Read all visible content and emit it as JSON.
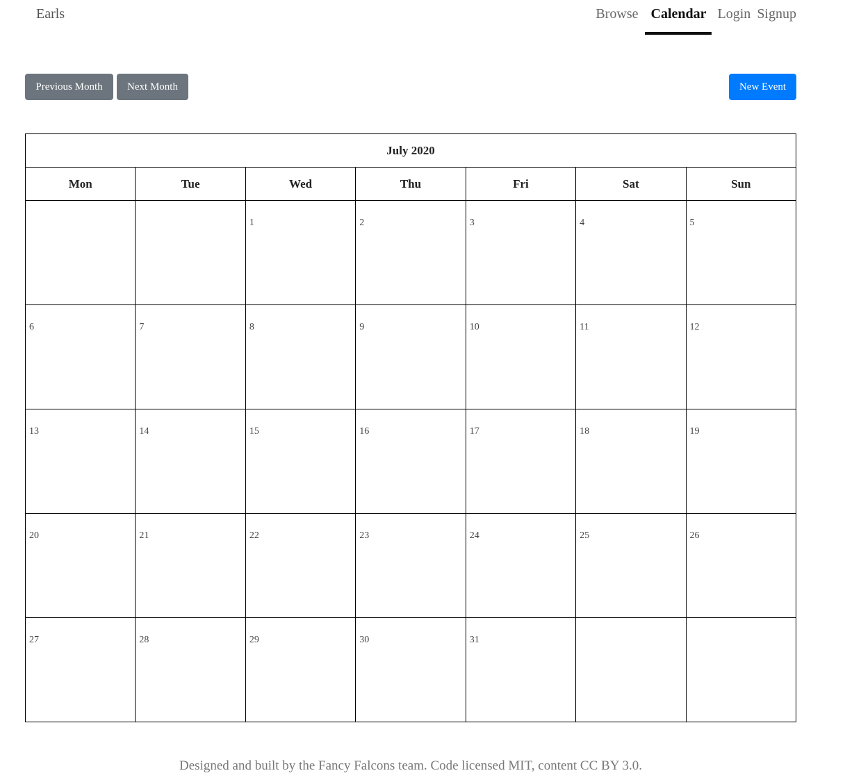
{
  "header": {
    "brand": "Earls",
    "nav": [
      {
        "label": "Browse",
        "active": false
      },
      {
        "label": "Calendar",
        "active": true
      },
      {
        "label": "Login",
        "active": false
      },
      {
        "label": "Signup",
        "active": false
      }
    ]
  },
  "toolbar": {
    "prev_label": "Previous Month",
    "next_label": "Next Month",
    "new_event_label": "New Event",
    "colors": {
      "secondary": "#6c757d",
      "primary": "#007bff"
    }
  },
  "calendar": {
    "month_title": "July 2020",
    "weekdays": [
      "Mon",
      "Tue",
      "Wed",
      "Thu",
      "Fri",
      "Sat",
      "Sun"
    ],
    "weeks": [
      [
        "",
        "",
        "1",
        "2",
        "3",
        "4",
        "5"
      ],
      [
        "6",
        "7",
        "8",
        "9",
        "10",
        "11",
        "12"
      ],
      [
        "13",
        "14",
        "15",
        "16",
        "17",
        "18",
        "19"
      ],
      [
        "20",
        "21",
        "22",
        "23",
        "24",
        "25",
        "26"
      ],
      [
        "27",
        "28",
        "29",
        "30",
        "31",
        "",
        ""
      ]
    ]
  },
  "footer": {
    "text": "Designed and built by the Fancy Falcons team. Code licensed MIT, content CC BY 3.0."
  }
}
